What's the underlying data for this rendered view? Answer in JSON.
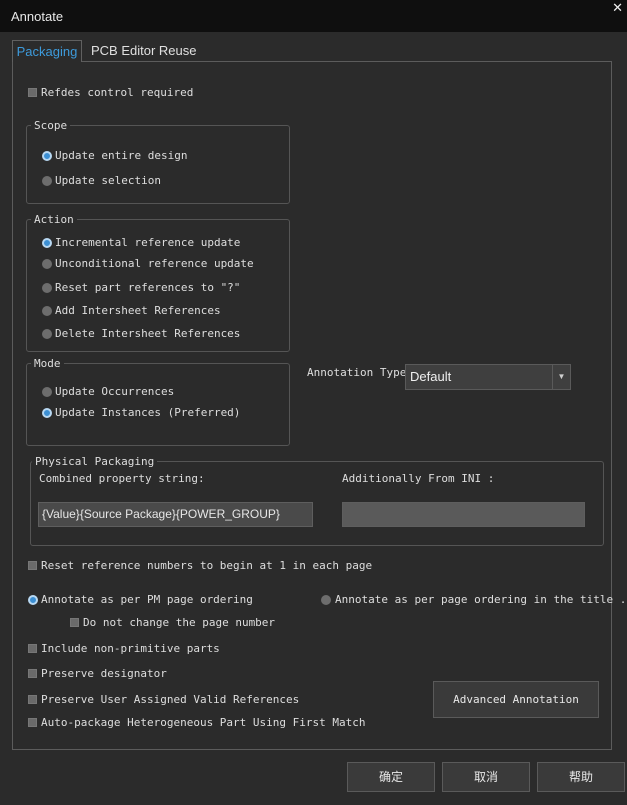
{
  "window": {
    "title": "Annotate"
  },
  "tabs": [
    {
      "label": "Packaging"
    },
    {
      "label": "PCB Editor Reuse"
    }
  ],
  "refdes": {
    "label": "Refdes control required"
  },
  "scope": {
    "legend": "Scope",
    "options": [
      "Update entire design",
      "Update selection"
    ]
  },
  "action": {
    "legend": "Action",
    "options": [
      "Incremental reference update",
      "Unconditional reference update",
      "Reset part references to \"?\"",
      "Add Intersheet References",
      "Delete Intersheet References"
    ]
  },
  "mode": {
    "legend": "Mode",
    "options": [
      "Update Occurrences",
      "Update Instances (Preferred)"
    ]
  },
  "annotation_type": {
    "label": "Annotation Type",
    "value": "Default"
  },
  "physical": {
    "legend": "Physical Packaging",
    "combined_label": "Combined property string:",
    "combined_value": "{Value}{Source Package}{POWER_GROUP}",
    "additional_label": "Additionally From INI :",
    "additional_value": ""
  },
  "options": {
    "reset_numbers": "Reset reference numbers to begin at 1 in each page",
    "annotate_pm": "Annotate as per PM page ordering",
    "annotate_title": "Annotate as per page ordering in the title ...",
    "no_change_page": "Do not change the page number",
    "include_nonprimitive": "Include non-primitive parts",
    "preserve_designator": "Preserve designator",
    "preserve_user": "Preserve User Assigned Valid References",
    "autopackage": "Auto-package Heterogeneous Part Using First Match"
  },
  "buttons": {
    "advanced": "Advanced Annotation",
    "ok": "确定",
    "cancel": "取消",
    "help": "帮助"
  }
}
